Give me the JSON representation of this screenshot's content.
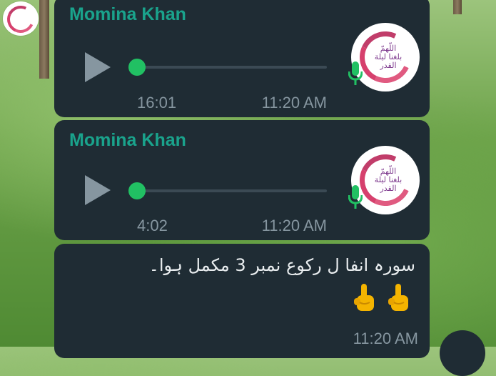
{
  "messages": [
    {
      "type": "voice",
      "sender": "Momina Khan",
      "duration": "16:01",
      "time": "11:20 AM",
      "avatar_text": "اللّهمّ بلغنا ليلة القدر"
    },
    {
      "type": "voice",
      "sender": "Momina Khan",
      "duration": "4:02",
      "time": "11:20 AM",
      "avatar_text": "اللّهمّ بلغنا ليلة القدر"
    },
    {
      "type": "text",
      "text": "سورہ انفا ل رکوع نمبر 3 مکمل    ہوا۔",
      "emojis": [
        "☝",
        "☝"
      ],
      "time": "11:20 AM"
    }
  ],
  "colors": {
    "bubble": "#1f2c34",
    "sender": "#1aa38c",
    "accent_green": "#21c063",
    "muted": "#8696a0"
  },
  "icons": [
    "play-icon",
    "mic-icon",
    "scroll-down-icon"
  ]
}
